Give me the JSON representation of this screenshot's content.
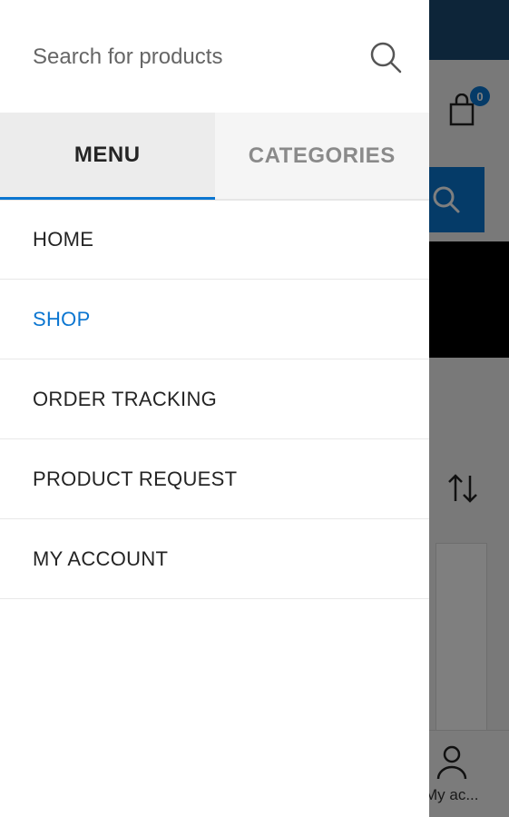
{
  "colors": {
    "accent": "#0b76d1",
    "topbar": "#1a4a73",
    "text": "#242424",
    "muted": "#8a8a8a"
  },
  "search": {
    "placeholder": "Search for products",
    "value": ""
  },
  "tabs": [
    {
      "label": "MENU",
      "active": true
    },
    {
      "label": "CATEGORIES",
      "active": false
    }
  ],
  "menu": {
    "items": [
      {
        "label": "HOME",
        "active": false
      },
      {
        "label": "SHOP",
        "active": true
      },
      {
        "label": "ORDER TRACKING",
        "active": false
      },
      {
        "label": "PRODUCT REQUEST",
        "active": false
      },
      {
        "label": "MY ACCOUNT",
        "active": false
      }
    ]
  },
  "background": {
    "cart_count": "0",
    "account_label": "My ac..."
  },
  "icons": {
    "search": "search-icon",
    "cart": "shopping-bag-icon",
    "sort": "sort-arrows-icon",
    "account": "user-icon"
  }
}
